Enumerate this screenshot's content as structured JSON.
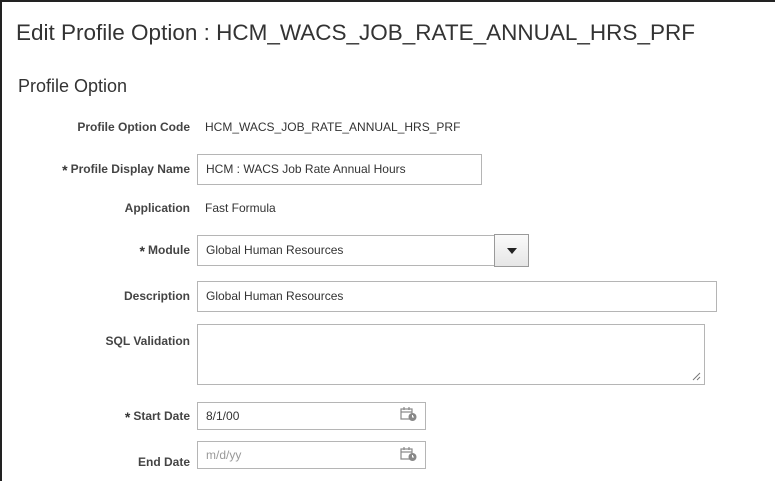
{
  "page": {
    "title": "Edit Profile Option : HCM_WACS_JOB_RATE_ANNUAL_HRS_PRF",
    "section_title": "Profile Option"
  },
  "form": {
    "profile_option_code": {
      "label": "Profile Option Code",
      "value": "HCM_WACS_JOB_RATE_ANNUAL_HRS_PRF"
    },
    "profile_display_name": {
      "label": "Profile Display Name",
      "value": "HCM : WACS Job Rate Annual Hours",
      "required": "*"
    },
    "application": {
      "label": "Application",
      "value": "Fast Formula"
    },
    "module": {
      "label": "Module",
      "value": "Global Human Resources",
      "required": "*"
    },
    "description": {
      "label": "Description",
      "value": "Global Human Resources"
    },
    "sql_validation": {
      "label": "SQL Validation",
      "value": ""
    },
    "start_date": {
      "label": "Start Date",
      "value": "8/1/00",
      "required": "*"
    },
    "end_date": {
      "label": "End Date",
      "value": "",
      "placeholder": "m/d/yy"
    }
  },
  "icons": {
    "module_dropdown": "chevron-down-icon",
    "start_date_picker": "calendar-icon",
    "end_date_picker": "calendar-icon"
  }
}
